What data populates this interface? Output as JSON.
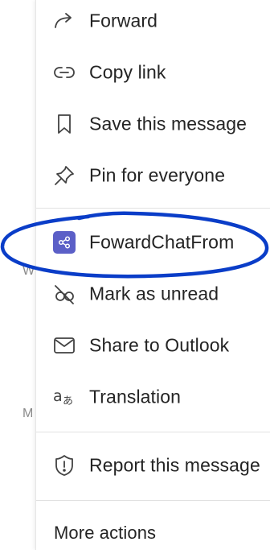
{
  "left_fragments": [
    "W",
    "M"
  ],
  "menu": {
    "items": [
      {
        "label": "Forward",
        "icon": "forward-arrow-icon"
      },
      {
        "label": "Copy link",
        "icon": "link-icon"
      },
      {
        "label": "Save this message",
        "icon": "bookmark-icon"
      },
      {
        "label": "Pin for everyone",
        "icon": "pin-icon"
      },
      {
        "label": "FowardChatFrom",
        "icon": "app-share-icon"
      },
      {
        "label": "Mark as unread",
        "icon": "eye-off-icon"
      },
      {
        "label": "Share to Outlook",
        "icon": "mail-icon"
      },
      {
        "label": "Translation",
        "icon": "translate-icon"
      },
      {
        "label": "Report this message",
        "icon": "shield-alert-icon"
      }
    ],
    "more_actions": "More actions"
  },
  "colors": {
    "highlight_ellipse": "#0a3dc8",
    "app_tile": "#5b5fc7",
    "text": "#242424",
    "icon_stroke": "#424242"
  }
}
